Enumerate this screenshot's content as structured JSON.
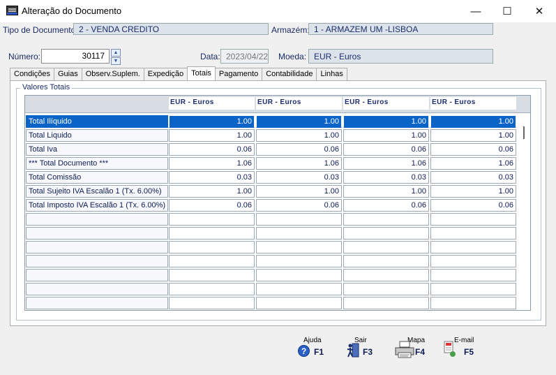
{
  "window": {
    "title": "Alteração do Documento",
    "minimize": "—",
    "maximize": "☐",
    "close": "✕"
  },
  "header": {
    "tipo_label": "Tipo de Documento:",
    "tipo_value": "2 - VENDA CREDITO",
    "armazem_label": "Armazém:",
    "armazem_value": "1 - ARMAZEM UM -LISBOA",
    "numero_label": "Número:",
    "numero_value": "30117",
    "data_label": "Data:",
    "data_value": "2023/04/22",
    "moeda_label": "Moeda:",
    "moeda_value": "EUR - Euros"
  },
  "tabs": [
    {
      "label": "Condições"
    },
    {
      "label": "Guias"
    },
    {
      "label": "Observ.Suplem."
    },
    {
      "label": "Expedição"
    },
    {
      "label": "Totais",
      "active": true
    },
    {
      "label": "Pagamento"
    },
    {
      "label": "Contabilidade"
    },
    {
      "label": "Linhas"
    }
  ],
  "totais": {
    "group_label": "Valores Totais",
    "columns": [
      "EUR - Euros",
      "EUR - Euros",
      "EUR - Euros",
      "EUR - Euros"
    ],
    "rows": [
      {
        "label": "Total Ilíquido",
        "values": [
          "1.00",
          "1.00",
          "1.00",
          "1.00"
        ]
      },
      {
        "label": "Total Liquido",
        "values": [
          "1.00",
          "1.00",
          "1.00",
          "1.00"
        ]
      },
      {
        "label": "Total Iva",
        "values": [
          "0.06",
          "0.06",
          "0.06",
          "0.06"
        ]
      },
      {
        "label": "*** Total Documento ***",
        "values": [
          "1.06",
          "1.06",
          "1.06",
          "1.06"
        ]
      },
      {
        "label": "Total Comissão",
        "values": [
          "0.03",
          "0.03",
          "0.03",
          "0.03"
        ]
      },
      {
        "label": "Total Sujeito IVA Escalão 1 (Tx. 6.00%)",
        "values": [
          "1.00",
          "1.00",
          "1.00",
          "1.00"
        ]
      },
      {
        "label": "Total Imposto IVA Escalão 1 (Tx. 6.00%)",
        "values": [
          "0.06",
          "0.06",
          "0.06",
          "0.06"
        ]
      },
      {
        "label": "",
        "values": [
          "",
          "",
          "",
          ""
        ]
      },
      {
        "label": "",
        "values": [
          "",
          "",
          "",
          ""
        ]
      },
      {
        "label": "",
        "values": [
          "",
          "",
          "",
          ""
        ]
      },
      {
        "label": "",
        "values": [
          "",
          "",
          "",
          ""
        ]
      },
      {
        "label": "",
        "values": [
          "",
          "",
          "",
          ""
        ]
      },
      {
        "label": "",
        "values": [
          "",
          "",
          "",
          ""
        ]
      },
      {
        "label": "",
        "values": [
          "",
          "",
          "",
          ""
        ]
      }
    ]
  },
  "footer": {
    "ajuda": {
      "caption": "Ajuda",
      "key": "F1"
    },
    "sair": {
      "caption": "Sair",
      "key": "F3"
    },
    "mapa": {
      "caption": "Mapa",
      "key": "F4"
    },
    "email": {
      "caption": "E-mail",
      "key": "F5"
    }
  },
  "colors": {
    "selection": "#0a64c8",
    "field_bg": "#dde3ea",
    "label_text": "#1a2a66"
  }
}
